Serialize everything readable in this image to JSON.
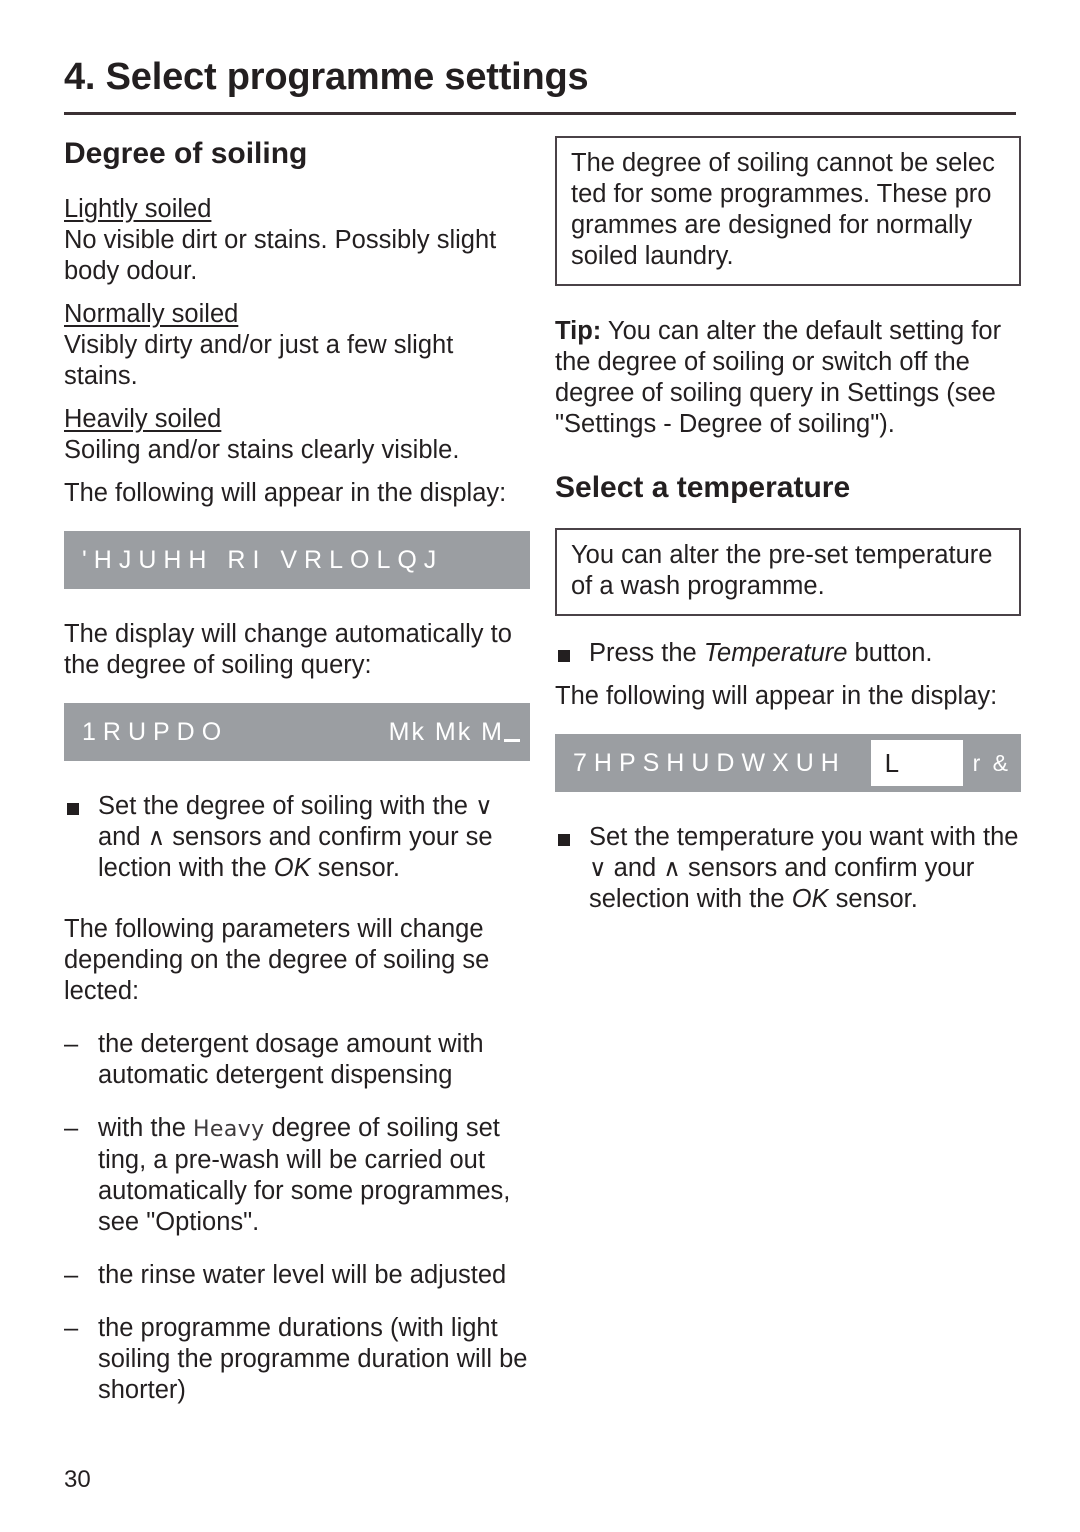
{
  "chapter": {
    "title": "4. Select programme settings"
  },
  "left_column": {
    "section_heading": "Degree of soiling",
    "levels": [
      {
        "label": "Lightly soiled",
        "description": "No visible dirt or stains. Possibly slight body odour."
      },
      {
        "label": "Normally soiled",
        "description": "Visibly dirty and/or just a few slight stains."
      },
      {
        "label": "Heavily soiled",
        "description": "Soiling and/or stains clearly visible."
      }
    ],
    "display_intro": "The following will appear in the display:",
    "display_1": {
      "text": "'HJUHH RI VRLOLQJ"
    },
    "after_display_1": "The display will change automatically to the degree of soiling query:",
    "display_2": {
      "text": "1RUPDO",
      "right_text": "Mk  Mk  M"
    },
    "bullet_1": {
      "prefix": "Set the degree of soiling with the ",
      "glyph_down": "∨",
      "mid": " and ",
      "glyph_up": "∧",
      "after": " sensors and confirm your se lection with the ",
      "italic": "OK",
      "tail": " sensor."
    },
    "params_intro": "The following parameters will change depending on the degree of soiling se lected:",
    "params": [
      {
        "pre": "",
        "display_word": "",
        "text": "the detergent dosage amount with automatic detergent dispensing"
      },
      {
        "pre": "with the ",
        "display_word": "Heavy",
        "text": " degree of soiling set ting, a pre-wash will be carried out automatically for some programmes, see \"Options\"."
      },
      {
        "pre": "",
        "display_word": "",
        "text": "the rinse water level will be adjusted"
      },
      {
        "pre": "",
        "display_word": "",
        "text": "the programme durations (with light soiling the programme duration will be shorter)"
      }
    ]
  },
  "right_column": {
    "note_1": "The degree of soiling cannot be selec ted for some programmes. These pro grammes are designed for normally soiled laundry.",
    "tip": {
      "label": "Tip:",
      "text": " You can alter the default setting for the degree of soiling or switch off the degree of soiling query in Settings (see \"Settings - Degree of soiling\")."
    },
    "section_heading": "Select a temperature",
    "note_2": "You can alter the pre-set temperature of a wash programme.",
    "bullet_press": {
      "prefix": "Press the ",
      "italic": "Temperature",
      "tail": " button."
    },
    "display_intro": "The following will appear in the display:",
    "display_temp": {
      "text": "7HPSHUDWXUH",
      "field_value": "L",
      "suffix": "r &"
    },
    "bullet_set": {
      "prefix": "Set the temperature you want with the ",
      "glyph_down": "∨",
      "mid": " and ",
      "glyph_up": "∧",
      "after": " sensors and confirm your selection with the ",
      "italic": "OK",
      "tail": " sensor."
    }
  },
  "footer": {
    "page_number": "30"
  },
  "colors": {
    "text": "#231f20",
    "display_bg": "#9b9ea2",
    "display_text": "#ffffff",
    "rule": "#3b3134",
    "box_border": "#4a4247"
  }
}
